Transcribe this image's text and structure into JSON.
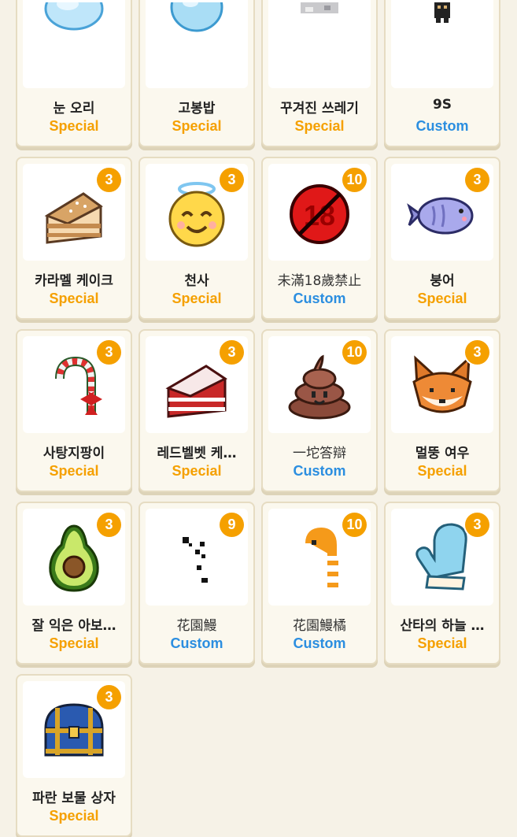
{
  "colors": {
    "background": "#f6f2e7",
    "special": "#f5a000",
    "custom": "#2b8ee0",
    "badge": "#f5a000"
  },
  "items": [
    {
      "name": "눈 오리",
      "kind": "Special",
      "kind_style": "special",
      "badge": "",
      "icon": "snow-duck-icon"
    },
    {
      "name": "고봉밥",
      "kind": "Special",
      "kind_style": "special",
      "badge": "",
      "icon": "rice-bowl-icon"
    },
    {
      "name": "꾸겨진 쓰레기",
      "kind": "Special",
      "kind_style": "special",
      "badge": "",
      "icon": "crumpled-trash-icon"
    },
    {
      "name": "9S",
      "kind": "Custom",
      "kind_style": "custom",
      "badge": "",
      "icon": "character-9s-icon"
    },
    {
      "name": "카라멜 케이크",
      "kind": "Special",
      "kind_style": "special",
      "badge": "3",
      "icon": "caramel-cake-icon"
    },
    {
      "name": "천사",
      "kind": "Special",
      "kind_style": "special",
      "badge": "3",
      "icon": "angel-emoji-icon"
    },
    {
      "name": "未滿18歲禁止",
      "kind": "Custom",
      "kind_style": "custom",
      "badge": "10",
      "icon": "no-under-18-icon"
    },
    {
      "name": "붕어",
      "kind": "Special",
      "kind_style": "special",
      "badge": "3",
      "icon": "fish-bread-icon"
    },
    {
      "name": "사탕지팡이",
      "kind": "Special",
      "kind_style": "special",
      "badge": "3",
      "icon": "candy-cane-icon"
    },
    {
      "name": "레드벨벳 케…",
      "kind": "Special",
      "kind_style": "special",
      "badge": "3",
      "icon": "red-velvet-cake-icon"
    },
    {
      "name": "一坨答辯",
      "kind": "Custom",
      "kind_style": "custom",
      "badge": "10",
      "icon": "poop-icon"
    },
    {
      "name": "멀뚱 여우",
      "kind": "Special",
      "kind_style": "special",
      "badge": "3",
      "icon": "fox-icon"
    },
    {
      "name": "잘 익은 아보…",
      "kind": "Special",
      "kind_style": "special",
      "badge": "3",
      "icon": "avocado-icon"
    },
    {
      "name": "花園鰻",
      "kind": "Custom",
      "kind_style": "custom",
      "badge": "9",
      "icon": "garden-eel-icon"
    },
    {
      "name": "花園鰻橘",
      "kind": "Custom",
      "kind_style": "custom",
      "badge": "10",
      "icon": "orange-garden-eel-icon"
    },
    {
      "name": "산타의 하늘 …",
      "kind": "Special",
      "kind_style": "special",
      "badge": "3",
      "icon": "mitten-icon"
    },
    {
      "name": "파란 보물 상자",
      "kind": "Special",
      "kind_style": "special",
      "badge": "3",
      "icon": "blue-treasure-chest-icon"
    }
  ]
}
